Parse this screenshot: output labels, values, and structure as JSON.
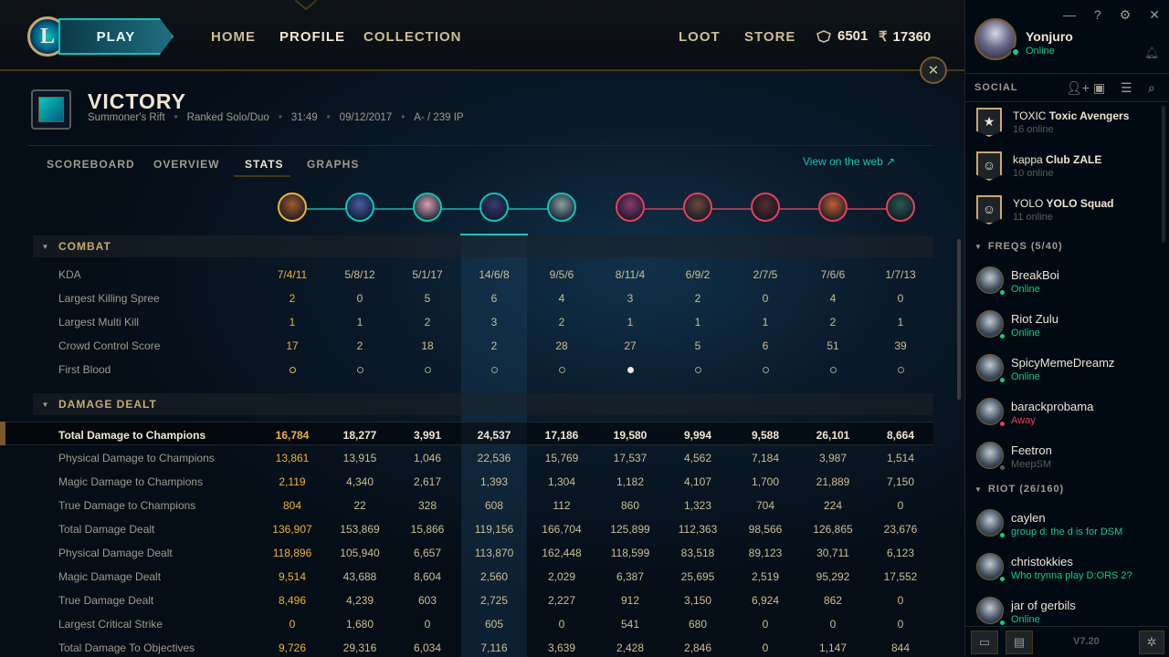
{
  "nav": {
    "play": "PLAY",
    "items": [
      "HOME",
      "PROFILE",
      "COLLECTION"
    ],
    "right_items": [
      "LOOT",
      "STORE"
    ],
    "blue_essence": "6501",
    "riot_points": "17360"
  },
  "match": {
    "title": "VICTORY",
    "map": "Summoner's Rift",
    "queue": "Ranked Solo/Duo",
    "duration": "31:49",
    "date": "09/12/2017",
    "grade": "A- / 239 IP"
  },
  "tabs": [
    "SCOREBOARD",
    "OVERVIEW",
    "STATS",
    "GRAPHS"
  ],
  "active_tab": "STATS",
  "view_web": "View on the web ↗",
  "champions": [
    {
      "team": "ally",
      "color": "#a35a2a",
      "me": true
    },
    {
      "team": "ally",
      "color": "#4a5aa0"
    },
    {
      "team": "ally",
      "color": "#d8a0b0"
    },
    {
      "team": "ally",
      "color": "#3a3a70"
    },
    {
      "team": "ally",
      "color": "#8aa0a0"
    },
    {
      "team": "enemy",
      "color": "#8a3a6a"
    },
    {
      "team": "enemy",
      "color": "#6a4a3a"
    },
    {
      "team": "enemy",
      "color": "#5a2a2a"
    },
    {
      "team": "enemy",
      "color": "#c06030"
    },
    {
      "team": "enemy",
      "color": "#2a5a4a"
    }
  ],
  "sections": [
    {
      "title": "COMBAT",
      "rows": [
        {
          "label": "KDA",
          "values": [
            "7/4/11",
            "5/8/12",
            "5/1/17",
            "14/6/8",
            "9/5/6",
            "8/11/4",
            "6/9/2",
            "2/7/5",
            "7/6/6",
            "1/7/13"
          ]
        },
        {
          "label": "Largest Killing Spree",
          "values": [
            "2",
            "0",
            "5",
            "6",
            "4",
            "3",
            "2",
            "0",
            "4",
            "0"
          ]
        },
        {
          "label": "Largest Multi Kill",
          "values": [
            "1",
            "1",
            "2",
            "3",
            "2",
            "1",
            "1",
            "1",
            "2",
            "1"
          ]
        },
        {
          "label": "Crowd Control Score",
          "values": [
            "17",
            "2",
            "18",
            "2",
            "28",
            "27",
            "5",
            "6",
            "51",
            "39"
          ]
        },
        {
          "label": "First Blood",
          "first_blood": [
            false,
            false,
            false,
            false,
            false,
            true,
            false,
            false,
            false,
            false
          ]
        }
      ]
    },
    {
      "title": "DAMAGE DEALT",
      "rows": [
        {
          "label": "Total Damage to Champions",
          "total": true,
          "values": [
            "16,784",
            "18,277",
            "3,991",
            "24,537",
            "17,186",
            "19,580",
            "9,994",
            "9,588",
            "26,101",
            "8,664"
          ]
        },
        {
          "label": "Physical Damage to Champions",
          "values": [
            "13,861",
            "13,915",
            "1,046",
            "22,536",
            "15,769",
            "17,537",
            "4,562",
            "7,184",
            "3,987",
            "1,514"
          ]
        },
        {
          "label": "Magic Damage to Champions",
          "values": [
            "2,119",
            "4,340",
            "2,617",
            "1,393",
            "1,304",
            "1,182",
            "4,107",
            "1,700",
            "21,889",
            "7,150"
          ]
        },
        {
          "label": "True Damage to Champions",
          "values": [
            "804",
            "22",
            "328",
            "608",
            "112",
            "860",
            "1,323",
            "704",
            "224",
            "0"
          ]
        },
        {
          "label": "Total Damage Dealt",
          "values": [
            "136,907",
            "153,869",
            "15,866",
            "119,156",
            "166,704",
            "125,899",
            "112,363",
            "98,566",
            "126,865",
            "23,676"
          ]
        },
        {
          "label": "Physical Damage Dealt",
          "values": [
            "118,896",
            "105,940",
            "6,657",
            "113,870",
            "162,448",
            "118,599",
            "83,518",
            "89,123",
            "30,711",
            "6,123"
          ]
        },
        {
          "label": "Magic Damage Dealt",
          "values": [
            "9,514",
            "43,688",
            "8,604",
            "2,560",
            "2,029",
            "6,387",
            "25,695",
            "2,519",
            "95,292",
            "17,552"
          ]
        },
        {
          "label": "True Damage Dealt",
          "values": [
            "8,496",
            "4,239",
            "603",
            "2,725",
            "2,227",
            "912",
            "3,150",
            "6,924",
            "862",
            "0"
          ]
        },
        {
          "label": "Largest Critical Strike",
          "values": [
            "0",
            "1,680",
            "0",
            "605",
            "0",
            "541",
            "680",
            "0",
            "0",
            "0"
          ]
        },
        {
          "label": "Total Damage To Objectives",
          "values": [
            "9,726",
            "29,316",
            "6,034",
            "7,116",
            "3,639",
            "2,428",
            "2,846",
            "0",
            "1,147",
            "844"
          ]
        }
      ]
    }
  ],
  "social": {
    "username": "Yonjuro",
    "status": "Online",
    "title": "SOCIAL",
    "clubs": [
      {
        "tag": "TOXIC",
        "name": "Toxic Avengers",
        "online": "16 online",
        "icon": "★"
      },
      {
        "tag": "kappa",
        "name": "Club ZALE",
        "online": "10 online",
        "icon": "☺"
      },
      {
        "tag": "YOLO",
        "name": "YOLO Squad",
        "online": "11 online",
        "icon": "☺"
      }
    ],
    "groups": [
      {
        "title": "FREQS (5/40)",
        "friends": [
          {
            "name": "BreakBoi",
            "status": "Online",
            "state": "online"
          },
          {
            "name": "Riot Zulu",
            "status": "Online",
            "state": "online"
          },
          {
            "name": "SpicyMemeDreamz",
            "status": "Online",
            "state": "online"
          },
          {
            "name": "barackprobama",
            "status": "Away",
            "state": "away"
          },
          {
            "name": "Feetron",
            "status": "MeepSM",
            "state": "ingame"
          }
        ]
      },
      {
        "title": "RIOT (26/160)",
        "friends": [
          {
            "name": "caylen",
            "status": "group d: the d is for DSM",
            "state": "online"
          },
          {
            "name": "christokkies",
            "status": "Who trynna play D:ORS 2?",
            "state": "online"
          },
          {
            "name": "jar of gerbils",
            "status": "Online",
            "state": "online"
          }
        ]
      }
    ],
    "version": "V7.20"
  },
  "colors": {
    "gold": "#c8aa6e",
    "highlight_gold": "#f0b232",
    "teal": "#0ac8b9",
    "enemy_red": "#e84057",
    "online_green": "#0acf83",
    "away_red": "#e84057",
    "ingame_gray": "#5b5a56"
  },
  "icons": [
    "logo-icon",
    "close-icon",
    "blue-essence-icon",
    "riot-points-icon",
    "minimize-icon",
    "help-icon",
    "settings-icon",
    "bell-icon",
    "add-friend-icon",
    "add-folder-icon",
    "list-icon",
    "search-icon",
    "chat-icon",
    "missions-icon",
    "bug-icon"
  ]
}
